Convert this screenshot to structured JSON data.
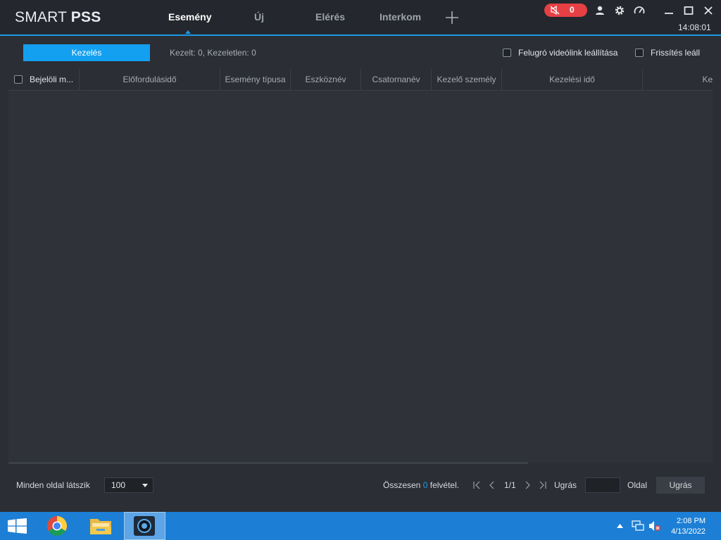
{
  "app": {
    "logo_regular": "SMART",
    "logo_bold": "PSS",
    "tabs": [
      "Esemény",
      "Új",
      "Elérés",
      "Interkom"
    ],
    "active_tab": "Esemény",
    "alarm_count": "0",
    "clock": "14:08:01",
    "accent_color": "#1c9be6",
    "alarm_color": "#e64045"
  },
  "toolbar": {
    "handle_button": "Kezelés",
    "stats": "Kezelt: 0, Kezeletlen: 0",
    "popup_video_stop": "Felugró videólink leállítása",
    "refresh_stop": "Frissítés leáll"
  },
  "table": {
    "columns": [
      "Bejelöli m...",
      "Előfordulásidő",
      "Esemény típusa",
      "Eszköznév",
      "Csatornanév",
      "Kezelő személy",
      "Kezelési idő",
      "Kezel"
    ],
    "rows": []
  },
  "footer": {
    "per_page_label": "Minden oldal látszik",
    "per_page_value": "100",
    "total_prefix": "Összesen",
    "total_count": "0",
    "total_suffix": "felvétel.",
    "page_indicator": "1/1",
    "jump_label": "Ugrás",
    "page_label": "Oldal",
    "jump_button": "Ugrás"
  },
  "taskbar": {
    "time": "2:08 PM",
    "date": "4/13/2022"
  }
}
